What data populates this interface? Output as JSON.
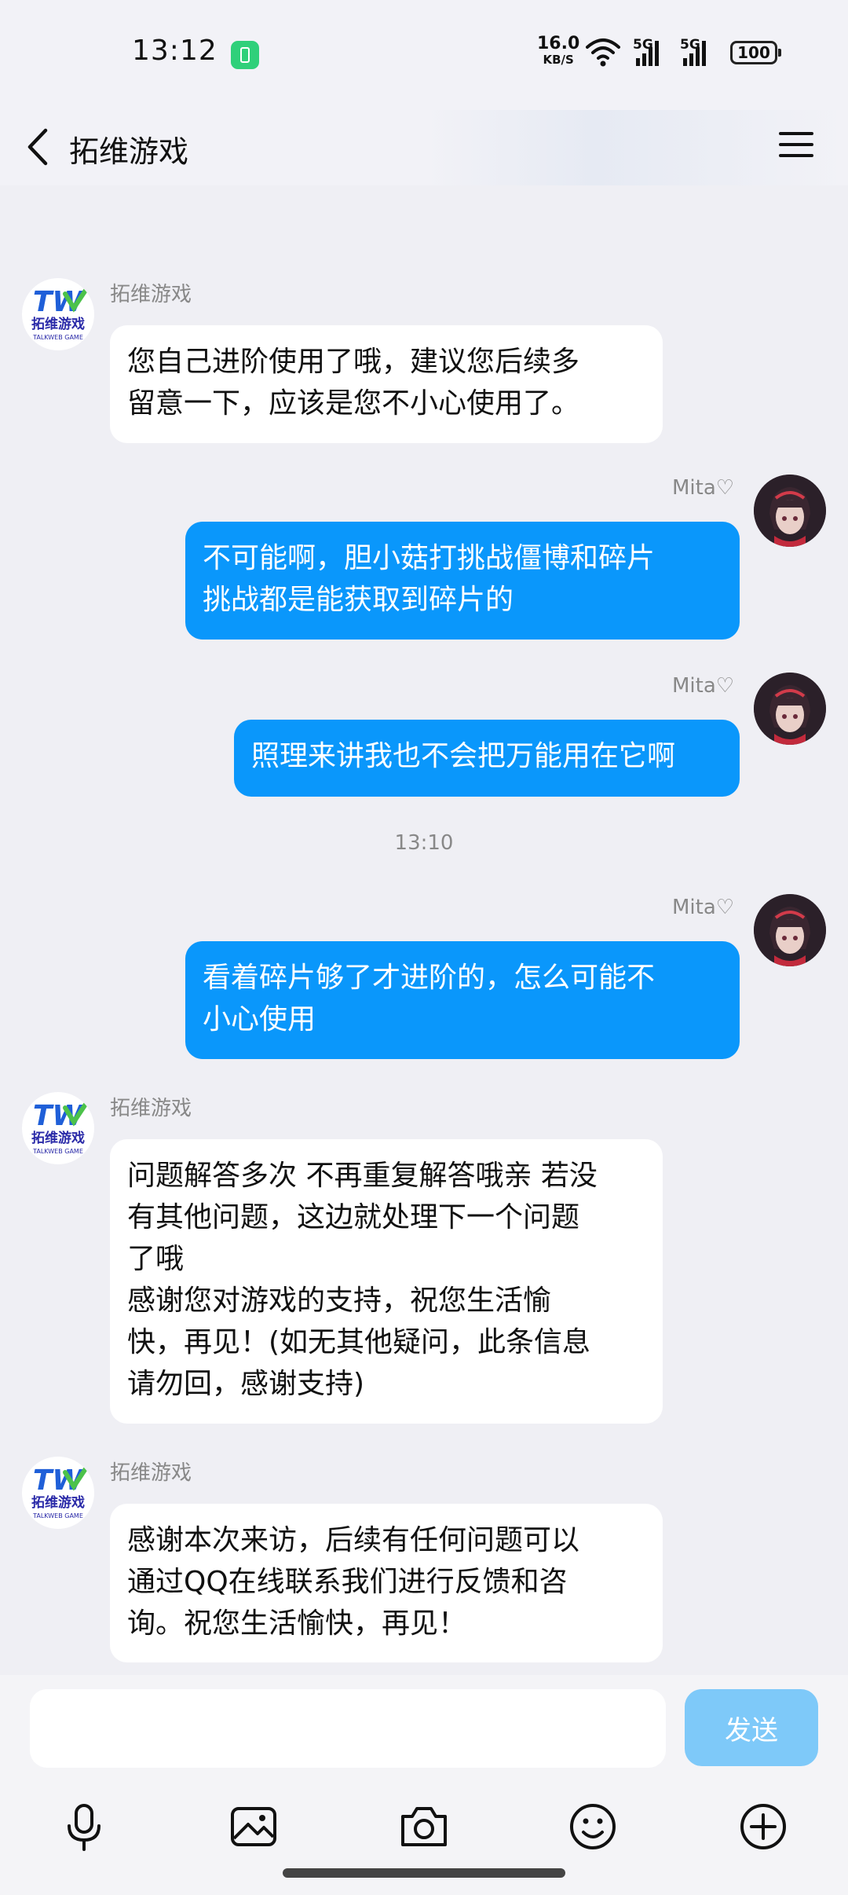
{
  "status_bar": {
    "time": "13:12",
    "net_speed_value": "16.0",
    "net_speed_unit": "KB/S",
    "signal_1_label": "5G",
    "signal_2_label": "5G",
    "battery": "100",
    "icons": [
      "battery-saver-icon",
      "wifi-icon",
      "signal-5g-icon",
      "signal-5g-icon",
      "battery-icon"
    ]
  },
  "header": {
    "title": "拓维游戏",
    "back_icon": "chevron-left-icon",
    "menu_icon": "hamburger-menu-icon"
  },
  "bot_logo": {
    "logo_text": "TW",
    "name_cn": "拓维游戏",
    "name_en": "TALKWEB GAME"
  },
  "messages": [
    {
      "sender": "拓维游戏",
      "text": "您自己进阶使用了哦，建议您后续多\n留意一下，应该是您不小心使用了。"
    },
    {
      "sender": "Mita♡",
      "text": "不可能啊，胆小菇打挑战僵博和碎片\n挑战都是能获取到碎片的"
    },
    {
      "sender": "Mita♡",
      "text": "照理来讲我也不会把万能用在它啊"
    },
    {
      "time": "13:10"
    },
    {
      "sender": "Mita♡",
      "text": "看着碎片够了才进阶的，怎么可能不\n小心使用"
    },
    {
      "sender": "拓维游戏",
      "text": "问题解答多次 不再重复解答哦亲 若没\n有其他问题，这边就处理下一个问题\n了哦\n感谢您对游戏的支持，祝您生活愉\n快，再见！(如无其他疑问，此条信息\n请勿回，感谢支持)"
    },
    {
      "sender": "拓维游戏",
      "text": "感谢本次来访，后续有任何问题可以\n通过QQ在线联系我们进行反馈和咨\n询。祝您生活愉快，再见！"
    }
  ],
  "composer": {
    "input_value": "",
    "send_label": "发送"
  },
  "toolbar": {
    "icons": [
      "microphone-icon",
      "image-icon",
      "camera-icon",
      "emoji-icon",
      "plus-circle-icon"
    ]
  },
  "colors": {
    "background": "#efeff4",
    "bubble_out": "#0a97fb",
    "bubble_in": "#ffffff",
    "send_button": "#7ec9f9"
  }
}
